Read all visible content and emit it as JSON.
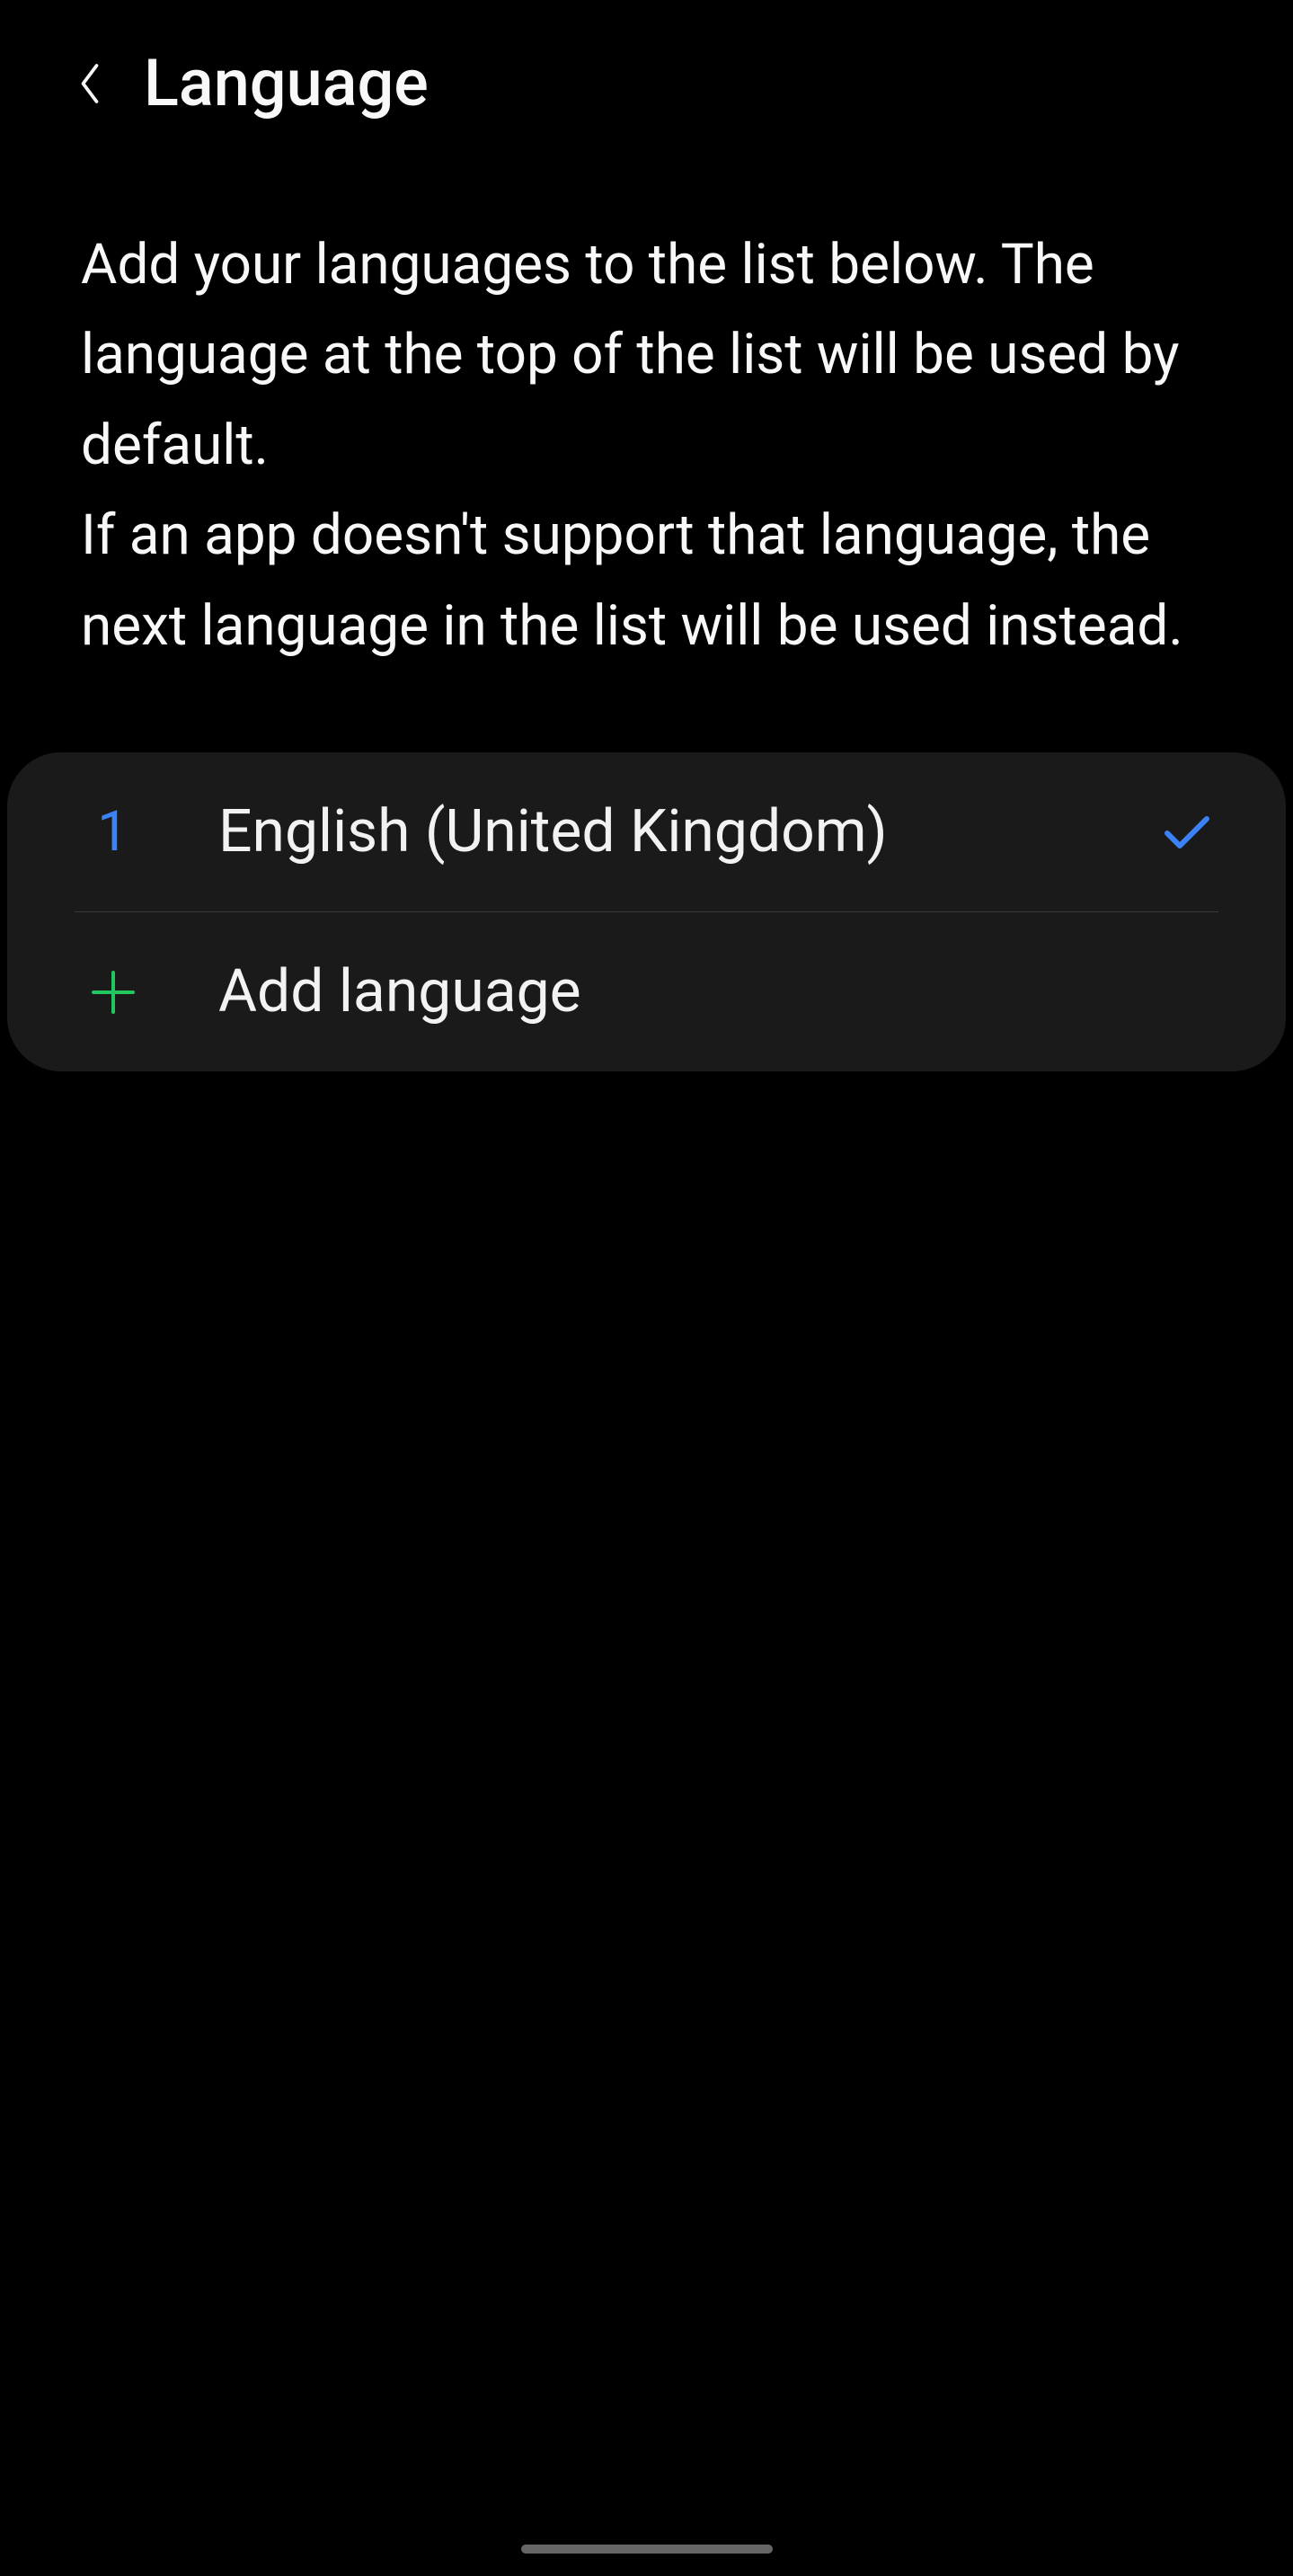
{
  "header": {
    "title": "Language"
  },
  "description": {
    "text": "Add your languages to the list below. The language at the top of the list will be used by default.\nIf an app doesn't support that language, the next language in the list will be used instead."
  },
  "languages": [
    {
      "rank": "1",
      "name": "English (United Kingdom)",
      "selected": true
    }
  ],
  "add": {
    "label": "Add language"
  },
  "colors": {
    "accent_blue": "#3b82f6",
    "accent_green": "#22c55e",
    "card_bg": "#1a1a1a"
  }
}
